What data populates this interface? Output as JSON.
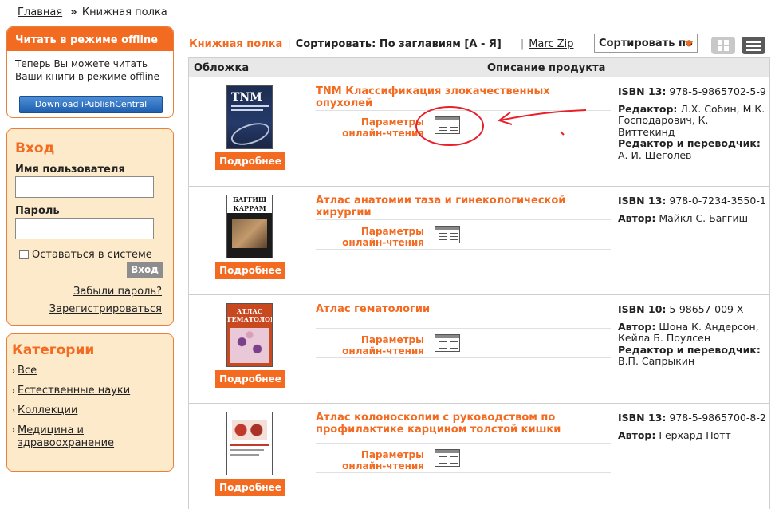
{
  "breadcrumb": {
    "home": "Главная",
    "separator": "»",
    "current": "Книжная полка"
  },
  "offline": {
    "title": "Читать в режиме offline",
    "text": "Теперь Вы можете читать Ваши книги в режиме offline",
    "button": "Download iPublishCentral Reader"
  },
  "login": {
    "title": "Вход",
    "username_label": "Имя пользователя",
    "password_label": "Пароль",
    "remember_label": "Оставаться в системе",
    "submit": "Вход",
    "forgot": "Забыли пароль?",
    "register": "Зарегистрироваться"
  },
  "categories": {
    "title": "Категории",
    "items": [
      {
        "label": "Все"
      },
      {
        "label": "Естественные науки"
      },
      {
        "label": "Коллекции"
      },
      {
        "label": "Медицина и здравоохранение"
      }
    ]
  },
  "toolbar": {
    "shelf": "Книжная полка",
    "sort_text": "Сортировать: По заглавиям [А - Я]",
    "marc": "Marc Zip",
    "sort_select": "Сортировать по"
  },
  "table": {
    "col_cover": "Обложка",
    "col_desc": "Описание продукта"
  },
  "colors": {
    "accent": "#f36a21",
    "annotation": "#e8202a"
  },
  "books": [
    {
      "title": "TNM Классификация злокачественных опухолей",
      "more": "Подробнее",
      "params": "Параметры онлайн-чтения",
      "isbn_label": "ISBN 13:",
      "isbn": "978-5-9865702-5-9",
      "role1_label": "Редактор:",
      "role1": "Л.Х. Собин, М.К. Господарович, К. Виттекинд",
      "role2_label": "Редактор и переводчик:",
      "role2": "А. И. Щеголев"
    },
    {
      "title": "Атлас анатомии таза и гинекологической хирургии",
      "more": "Подробнее",
      "params": "Параметры онлайн-чтения",
      "isbn_label": "ISBN 13:",
      "isbn": "978-0-7234-3550-1",
      "role1_label": "Автор:",
      "role1": "Майкл С. Баггиш"
    },
    {
      "title": "Атлас гематологии",
      "more": "Подробнее",
      "params": "Параметры онлайн-чтения",
      "isbn_label": "ISBN 10:",
      "isbn": "5-98657-009-X",
      "role1_label": "Автор:",
      "role1": "Шона К. Андерсон, Кейла Б. Поулсен",
      "role2_label": "Редактор и переводчик:",
      "role2": "В.П. Сапрыкин"
    },
    {
      "title": "Атлас колоноскопии с руководством по профилактике карцином толстой кишки",
      "more": "Подробнее",
      "params": "Параметры онлайн-чтения",
      "isbn_label": "ISBN 13:",
      "isbn": "978-5-9865700-8-2",
      "role1_label": "Автор:",
      "role1": "Герхард Потт"
    }
  ]
}
